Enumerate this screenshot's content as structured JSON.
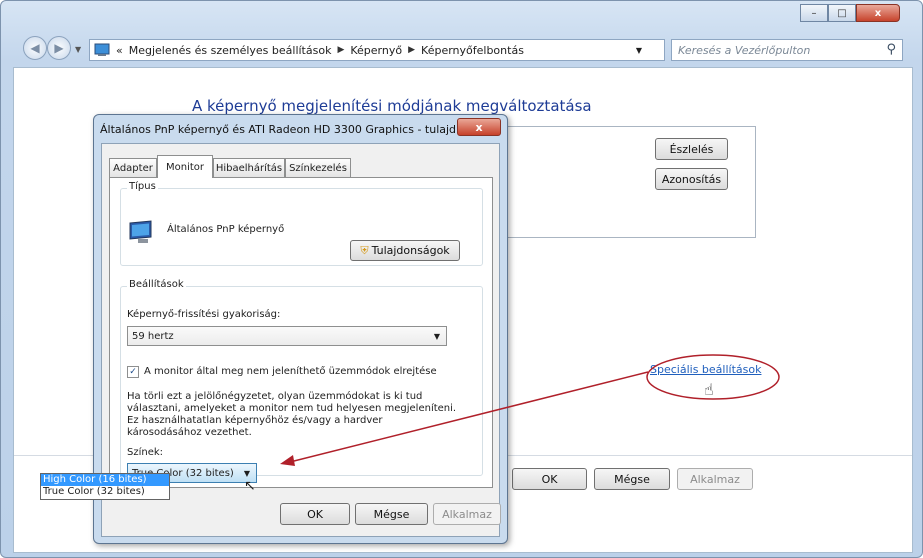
{
  "window": {
    "controls": {
      "minimize": "–",
      "maximize": "□",
      "close": "x"
    },
    "breadcrumb": {
      "prefix": "«",
      "items": [
        "Megjelenés és személyes beállítások",
        "Képernyő",
        "Képernyőfelbontás"
      ]
    },
    "search_placeholder": "Keresés a Vezérlőpulton"
  },
  "main": {
    "heading": "A képernyő megjelenítési módjának megváltoztatása",
    "detect_button": "Észlelés",
    "identify_button": "Azonosítás",
    "advanced_link": "Speciális beállítások",
    "ok_button": "OK",
    "cancel_button": "Mégse",
    "apply_button": "Alkalmaz"
  },
  "dialog": {
    "title": "Általános PnP képernyő és ATI Radeon HD 3300 Graphics - tulajd...",
    "close": "x",
    "tabs": [
      "Adapter",
      "Monitor",
      "Hibaelhárítás",
      "Színkezelés"
    ],
    "active_tab": "Monitor",
    "type_group": "Típus",
    "monitor_name": "Általános PnP képernyő",
    "properties_button": "Tulajdonságok",
    "settings_group": "Beállítások",
    "refresh_label": "Képernyő-frissítési gyakoriság:",
    "refresh_value": "59 hertz",
    "hide_modes_checked": true,
    "hide_modes_label": "A monitor által meg nem jeleníthető üzemmódok elrejtése",
    "hide_modes_desc": "Ha törli ezt a jelölőnégyzetet, olyan üzemmódokat is ki tud választani, amelyeket a monitor nem tud helyesen megjeleníteni. Ez használhatatlan képernyőhöz és/vagy a hardver károsodásához vezethet.",
    "colors_label": "Színek:",
    "colors_value": "True Color (32 bites)",
    "color_options": [
      "High Color (16 bites)",
      "True Color (32 bites)"
    ],
    "highlighted_option": "High Color (16 bites)",
    "ok_button": "OK",
    "cancel_button": "Mégse",
    "apply_button": "Alkalmaz"
  },
  "colors": {
    "annotation": "#b0202a",
    "link": "#1f5fbd",
    "heading": "#1e3c96"
  }
}
